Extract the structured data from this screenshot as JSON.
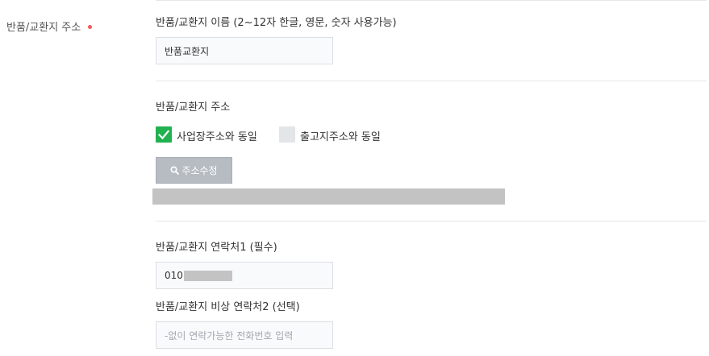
{
  "section": {
    "label": "반품/교환지 주소"
  },
  "name_field": {
    "label": "반품/교환지 이름 (2~12자 한글, 영문, 숫자 사용가능)",
    "value": "반품교환지"
  },
  "address_field": {
    "label": "반품/교환지 주소",
    "options": [
      {
        "label": "사업장주소와 동일",
        "checked": true
      },
      {
        "label": "출고지주소와 동일",
        "checked": false
      }
    ],
    "edit_button_label": "주소수정"
  },
  "contact1_field": {
    "label": "반품/교환지 연락처1 (필수)",
    "value": "010"
  },
  "contact2_field": {
    "label": "반품/교환지 비상 연락처2 (선택)",
    "placeholder": "-없이 연락가능한 전화번호 입력"
  },
  "colors": {
    "required_dot": "#f05a5a",
    "checkbox_checked": "#21b14f",
    "button_bg": "#b7bcc3"
  },
  "icons": {
    "required": "dot",
    "checked": "check-icon",
    "button": "search-icon"
  }
}
